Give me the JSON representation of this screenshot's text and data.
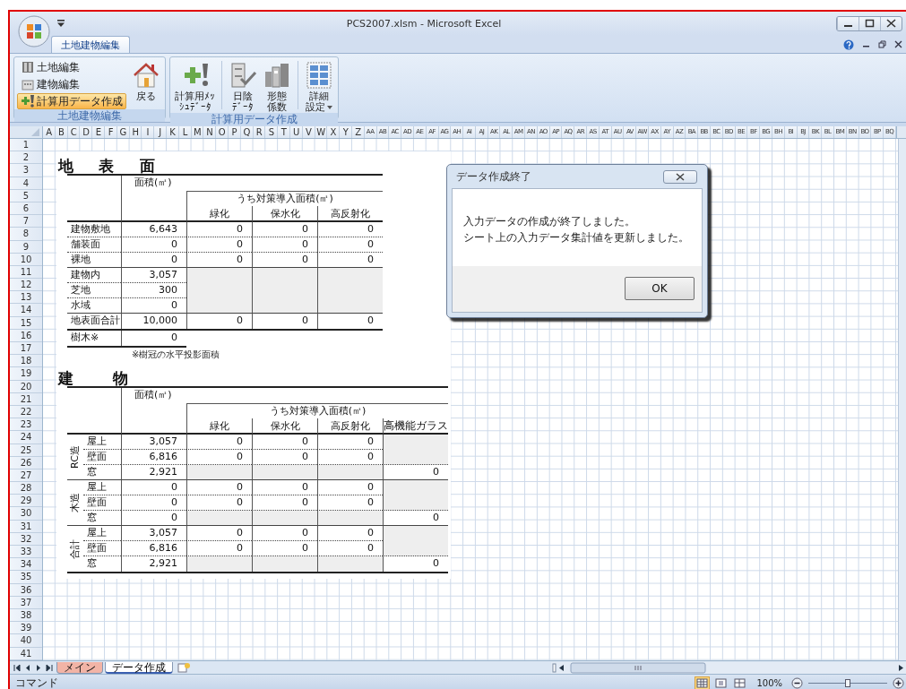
{
  "window": {
    "title": "PCS2007.xlsm - Microsoft Excel"
  },
  "ribbon": {
    "tabs": [
      {
        "label": "土地建物編集",
        "selected": true
      }
    ],
    "groups": [
      {
        "caption": "土地建物編集",
        "small_buttons": [
          {
            "label": "土地編集",
            "kind": "book",
            "selected": false
          },
          {
            "label": "建物編集",
            "kind": "building",
            "selected": false
          },
          {
            "label": "計算用データ作成",
            "kind": "plus",
            "selected": true
          }
        ],
        "large_buttons": [
          {
            "lines": [
              "戻る"
            ],
            "kind": "house"
          }
        ]
      },
      {
        "caption": "計算用データ作成",
        "large_buttons": [
          {
            "lines": [
              "計算用ﾒｯ",
              "ｼｭﾃﾞｰﾀ"
            ],
            "kind": "plus"
          },
          {
            "lines": [
              "日陰",
              "ﾃﾞｰﾀ"
            ],
            "kind": "cabinet",
            "separator_before": true
          },
          {
            "lines": [
              "形態",
              "係数"
            ],
            "kind": "buildings"
          },
          {
            "lines": [
              "詳細",
              "設定"
            ],
            "kind": "grid",
            "separator_before": true,
            "dropdown": true
          }
        ]
      }
    ]
  },
  "sheet": {
    "column_headers": [
      "A",
      "B",
      "C",
      "D",
      "E",
      "F",
      "G",
      "H",
      "I",
      "J",
      "K",
      "L",
      "M",
      "N",
      "O",
      "P",
      "Q",
      "R",
      "S",
      "T",
      "U",
      "V",
      "W",
      "X",
      "Y",
      "Z",
      "AA",
      "AB",
      "AC",
      "AD",
      "AE",
      "AF",
      "AG",
      "AH",
      "AI",
      "AJ",
      "AK",
      "AL",
      "AM",
      "AN",
      "AO",
      "AP",
      "AQ",
      "AR",
      "AS",
      "AT",
      "AU",
      "AV",
      "AW",
      "AX",
      "AY",
      "AZ",
      "BA",
      "BB",
      "BC",
      "BD",
      "BE",
      "BF",
      "BG",
      "BH",
      "BI",
      "BJ",
      "BK",
      "BL",
      "BM",
      "BN",
      "BO",
      "BP",
      "BQ"
    ],
    "row_headers": [
      "1",
      "2",
      "3",
      "4",
      "5",
      "6",
      "7",
      "8",
      "9",
      "10",
      "11",
      "12",
      "13",
      "14",
      "15",
      "16",
      "17",
      "18",
      "19",
      "20",
      "21",
      "22",
      "23",
      "24",
      "25",
      "26",
      "27",
      "28",
      "29",
      "30",
      "31",
      "32",
      "33",
      "34",
      "35",
      "36",
      "37",
      "38",
      "39",
      "40",
      "41"
    ]
  },
  "tables": [
    {
      "title": "地 表 面",
      "area_header": "面積(㎡)",
      "sub_header": "うち対策導入面積(㎡)",
      "columns": [
        "緑化",
        "保水化",
        "高反射化"
      ],
      "groups": [
        {
          "rows": [
            {
              "label": "建物敷地",
              "area": "6,643",
              "cells": [
                {
                  "kind": "value",
                  "text": "0"
                },
                {
                  "kind": "value",
                  "text": "0"
                },
                {
                  "kind": "value",
                  "text": "0"
                }
              ]
            },
            {
              "label": "舗装面",
              "area": "0",
              "cells": [
                {
                  "kind": "value",
                  "text": "0"
                },
                {
                  "kind": "value",
                  "text": "0"
                },
                {
                  "kind": "value",
                  "text": "0"
                }
              ]
            },
            {
              "label": "裸地",
              "area": "0",
              "cells": [
                {
                  "kind": "value",
                  "text": "0"
                },
                {
                  "kind": "value",
                  "text": "0"
                },
                {
                  "kind": "value",
                  "text": "0"
                }
              ]
            }
          ]
        },
        {
          "rows": [
            {
              "label": "建物内",
              "area": "3,057",
              "cells": [
                {
                  "kind": "shaded"
                },
                {
                  "kind": "shaded"
                },
                {
                  "kind": "shaded"
                }
              ]
            },
            {
              "label": "芝地",
              "area": "300",
              "cells": [
                {
                  "kind": "shaded"
                },
                {
                  "kind": "shaded"
                },
                {
                  "kind": "shaded"
                }
              ]
            },
            {
              "label": "水域",
              "area": "0",
              "cells": [
                {
                  "kind": "shaded"
                },
                {
                  "kind": "shaded"
                },
                {
                  "kind": "shaded"
                }
              ]
            }
          ]
        },
        {
          "rows": [
            {
              "label": "地表面合計",
              "area": "10,000",
              "cells": [
                {
                  "kind": "value",
                  "text": "0"
                },
                {
                  "kind": "value",
                  "text": "0"
                },
                {
                  "kind": "value",
                  "text": "0"
                }
              ]
            }
          ]
        }
      ],
      "extra_row": {
        "label": "樹木※",
        "area": "0"
      },
      "note": "※樹冠の水平投影面積"
    },
    {
      "title": "建 物",
      "area_header": "面積(㎡)",
      "sub_header": "うち対策導入面積(㎡)",
      "columns": [
        "緑化",
        "保水化",
        "高反射化",
        "高機能ガラス"
      ],
      "groups": [
        {
          "label": "RC造",
          "rows": [
            {
              "label": "屋上",
              "area": "3,057",
              "cells": [
                {
                  "kind": "value",
                  "text": "0"
                },
                {
                  "kind": "value",
                  "text": "0"
                },
                {
                  "kind": "value",
                  "text": "0"
                },
                {
                  "kind": "shaded"
                }
              ]
            },
            {
              "label": "壁面",
              "area": "6,816",
              "cells": [
                {
                  "kind": "value",
                  "text": "0"
                },
                {
                  "kind": "value",
                  "text": "0"
                },
                {
                  "kind": "value",
                  "text": "0"
                },
                {
                  "kind": "shaded"
                }
              ]
            },
            {
              "label": "窓",
              "area": "2,921",
              "cells": [
                {
                  "kind": "shaded"
                },
                {
                  "kind": "shaded"
                },
                {
                  "kind": "shaded"
                },
                {
                  "kind": "value",
                  "text": "0"
                }
              ]
            }
          ]
        },
        {
          "label": "木造",
          "rows": [
            {
              "label": "屋上",
              "area": "0",
              "cells": [
                {
                  "kind": "value",
                  "text": "0"
                },
                {
                  "kind": "value",
                  "text": "0"
                },
                {
                  "kind": "value",
                  "text": "0"
                },
                {
                  "kind": "shaded"
                }
              ]
            },
            {
              "label": "壁面",
              "area": "0",
              "cells": [
                {
                  "kind": "value",
                  "text": "0"
                },
                {
                  "kind": "value",
                  "text": "0"
                },
                {
                  "kind": "value",
                  "text": "0"
                },
                {
                  "kind": "shaded"
                }
              ]
            },
            {
              "label": "窓",
              "area": "0",
              "cells": [
                {
                  "kind": "shaded"
                },
                {
                  "kind": "shaded"
                },
                {
                  "kind": "shaded"
                },
                {
                  "kind": "value",
                  "text": "0"
                }
              ]
            }
          ]
        },
        {
          "label": "合計",
          "rows": [
            {
              "label": "屋上",
              "area": "3,057",
              "cells": [
                {
                  "kind": "value",
                  "text": "0"
                },
                {
                  "kind": "value",
                  "text": "0"
                },
                {
                  "kind": "value",
                  "text": "0"
                },
                {
                  "kind": "shaded"
                }
              ]
            },
            {
              "label": "壁面",
              "area": "6,816",
              "cells": [
                {
                  "kind": "value",
                  "text": "0"
                },
                {
                  "kind": "value",
                  "text": "0"
                },
                {
                  "kind": "value",
                  "text": "0"
                },
                {
                  "kind": "shaded"
                }
              ]
            },
            {
              "label": "窓",
              "area": "2,921",
              "cells": [
                {
                  "kind": "shaded"
                },
                {
                  "kind": "shaded"
                },
                {
                  "kind": "shaded"
                },
                {
                  "kind": "value",
                  "text": "0"
                }
              ]
            }
          ]
        }
      ]
    }
  ],
  "dialog": {
    "title": "データ作成終了",
    "message": [
      "入力データの作成が終了しました。",
      "シート上の入力データ集計値を更新しました。"
    ],
    "button": "OK"
  },
  "sheet_tabs": [
    {
      "label": "メイン",
      "selected": false,
      "color": "#f2b4a6"
    },
    {
      "label": "データ作成",
      "selected": true
    }
  ],
  "status_bar": {
    "mode": "コマンド",
    "views": [
      {
        "kind": "normal",
        "selected": true
      },
      {
        "kind": "page_layout",
        "selected": false
      },
      {
        "kind": "page_break",
        "selected": false
      }
    ],
    "zoom": {
      "label": "100%",
      "level": 0.5
    }
  }
}
